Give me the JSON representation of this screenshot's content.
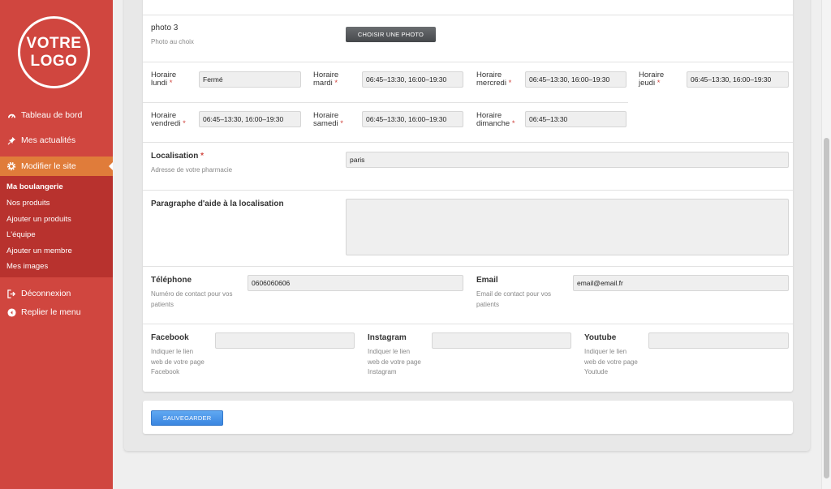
{
  "logo": {
    "line1": "VOTRE",
    "line2": "LOGO"
  },
  "nav": {
    "dashboard": "Tableau de bord",
    "news": "Mes actualités",
    "edit_site": "Modifier le site",
    "submenu": [
      "Ma boulangerie",
      "Nos produits",
      "Ajouter un produits",
      "L'équipe",
      "Ajouter un membre",
      "Mes images"
    ],
    "logout": "Déconnexion",
    "collapse": "Replier le menu"
  },
  "photo3": {
    "label": "photo 3",
    "hint": "Photo au choix",
    "button": "CHOISIR UNE PHOTO"
  },
  "hours": [
    {
      "label1": "Horaire",
      "label2": "lundi",
      "value": "Fermé"
    },
    {
      "label1": "Horaire",
      "label2": "mardi",
      "value": "06:45–13:30, 16:00–19:30"
    },
    {
      "label1": "Horaire",
      "label2": "mercredi",
      "value": "06:45–13:30, 16:00–19:30"
    },
    {
      "label1": "Horaire",
      "label2": "jeudi",
      "value": "06:45–13:30, 16:00–19:30"
    },
    {
      "label1": "Horaire",
      "label2": "vendredi",
      "value": "06:45–13:30, 16:00–19:30"
    },
    {
      "label1": "Horaire",
      "label2": "samedi",
      "value": "06:45–13:30, 16:00–19:30"
    },
    {
      "label1": "Horaire",
      "label2": "dimanche",
      "value": "06:45–13:30"
    }
  ],
  "required_mark": "*",
  "location": {
    "label": "Localisation",
    "hint": "Adresse de votre pharmacie",
    "value": "paris"
  },
  "location_help": {
    "label": "Paragraphe d'aide à la localisation",
    "value": ""
  },
  "phone": {
    "label": "Téléphone",
    "hint1": "Numéro de contact pour vos",
    "hint2": "patients",
    "value": "0606060606"
  },
  "email": {
    "label": "Email",
    "hint1": "Email de contact pour vos",
    "hint2": "patients",
    "value": "email@email.fr"
  },
  "social": [
    {
      "label": "Facebook",
      "hint": [
        "Indiquer le lien",
        "web de votre page",
        "Facebook"
      ],
      "value": ""
    },
    {
      "label": "Instagram",
      "hint": [
        "Indiquer le lien",
        "web de votre page",
        "Instagram"
      ],
      "value": ""
    },
    {
      "label": "Youtube",
      "hint": [
        "Indiquer le lien",
        "web de votre page",
        "Youtude"
      ],
      "value": ""
    }
  ],
  "save_button": "SAUVEGARDER",
  "colors": {
    "sidebar": "#d0463f",
    "active": "#e07c3a",
    "submenu": "#b8322e",
    "accent_blue": "#3b86e0"
  }
}
